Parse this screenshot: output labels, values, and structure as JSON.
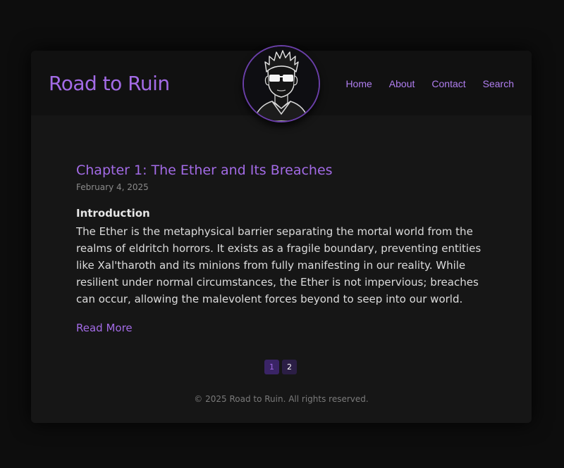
{
  "header": {
    "site_title": "Road to Ruin",
    "nav": [
      {
        "label": "Home"
      },
      {
        "label": "About"
      },
      {
        "label": "Contact"
      },
      {
        "label": "Search"
      }
    ],
    "avatar_icon": "sunglasses-portrait-icon"
  },
  "post": {
    "title": "Chapter 1: The Ether and Its Breaches",
    "date": "February 4, 2025",
    "section_heading": "Introduction",
    "body": "The Ether is the metaphysical barrier separating the mortal world from the realms of eldritch horrors. It exists as a fragile boundary, preventing entities like Xal'tharoth and its minions from fully manifesting in our reality. While resilient under normal circumstances, the Ether is not impervious; breaches can occur, allowing the malevolent forces beyond to seep into our world.",
    "read_more": "Read More"
  },
  "pagination": {
    "pages": [
      "1",
      "2"
    ],
    "current": "1"
  },
  "footer": {
    "text": "© 2025 Road to Ruin. All rights reserved."
  },
  "colors": {
    "accent": "#a36be6",
    "background": "#0d0d0d",
    "card": "#161616",
    "header": "#111111"
  }
}
